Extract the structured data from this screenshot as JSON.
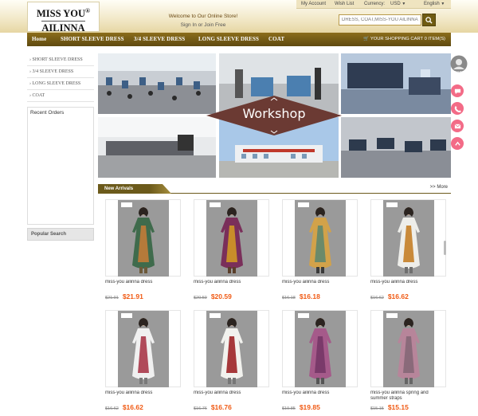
{
  "logo": {
    "line1": "MISS YOU",
    "mark": "®",
    "line2": "AILINNA"
  },
  "header": {
    "welcome": "Welcome to Our Online Store!",
    "sign_in": "Sign In",
    "or": "or",
    "join_free": "Join Free"
  },
  "topbar": {
    "my_account": "My Account",
    "wish_list": "Wish List",
    "currency_label": "Currency:",
    "currency_value": "USD",
    "language": "English"
  },
  "search": {
    "placeholder": "DRESS, COAT,MISS-YOU AILINNA"
  },
  "nav": {
    "items": [
      "Home",
      "SHORT SLEEVE DRESS",
      "3/4 SLEEVE DRESS",
      "LONG SLEEVE DRESS",
      "COAT"
    ],
    "cart": "YOUR SHOPPING CART 0 ITEM(S)"
  },
  "left_menu": {
    "items": [
      "SHORT SLEEVE DRESS",
      "3/4 SLEEVE DRESS",
      "LONG SLEEVE DRESS",
      "COAT"
    ]
  },
  "recent_orders": {
    "title": "Recent Orders"
  },
  "popular_search": {
    "title": "Popular Search"
  },
  "banner": {
    "title": "Workshop"
  },
  "new_arrivals": {
    "title": "New Arrivals",
    "more": ">> More"
  },
  "products": [
    {
      "name": "miss-you ailinna dress",
      "old_price": "$21.91",
      "price": "$21.91",
      "colors": [
        "#3f6b4c",
        "#b57a3a",
        "#6d5a3a"
      ]
    },
    {
      "name": "miss-you ailinna dress",
      "old_price": "$20.59",
      "price": "$20.59",
      "colors": [
        "#7a2f5a",
        "#c88d2a",
        "#5a3e2a"
      ]
    },
    {
      "name": "miss-you ailinna dress",
      "old_price": "$16.18",
      "price": "$16.18",
      "colors": [
        "#d2a24a",
        "#6b8a6a",
        "#3a3a3a"
      ]
    },
    {
      "name": "miss-you ailinna dress",
      "old_price": "$16.62",
      "price": "$16.62",
      "colors": [
        "#eeeeea",
        "#c98a3a",
        "#6f6f6f"
      ]
    },
    {
      "name": "miss-you ailinna dress",
      "old_price": "$16.62",
      "price": "$16.62",
      "colors": [
        "#f0f0f0",
        "#b04a5a",
        "#7a7a7a"
      ]
    },
    {
      "name": "miss-you ailinna dress",
      "old_price": "$16.76",
      "price": "$16.76",
      "colors": [
        "#f2f2ee",
        "#a6383a",
        "#777777"
      ]
    },
    {
      "name": "miss-you ailinna dress",
      "old_price": "$19.85",
      "price": "$19.85",
      "colors": [
        "#a55a8a",
        "#7a3a6a",
        "#555555"
      ]
    },
    {
      "name": "miss-you ailinna spring and summer straps",
      "old_price": "$15.15",
      "price": "$15.15",
      "colors": [
        "#b7859a",
        "#8a6a7a",
        "#666666"
      ]
    }
  ],
  "side_widget": {
    "avatar_label": "ONLINE"
  }
}
